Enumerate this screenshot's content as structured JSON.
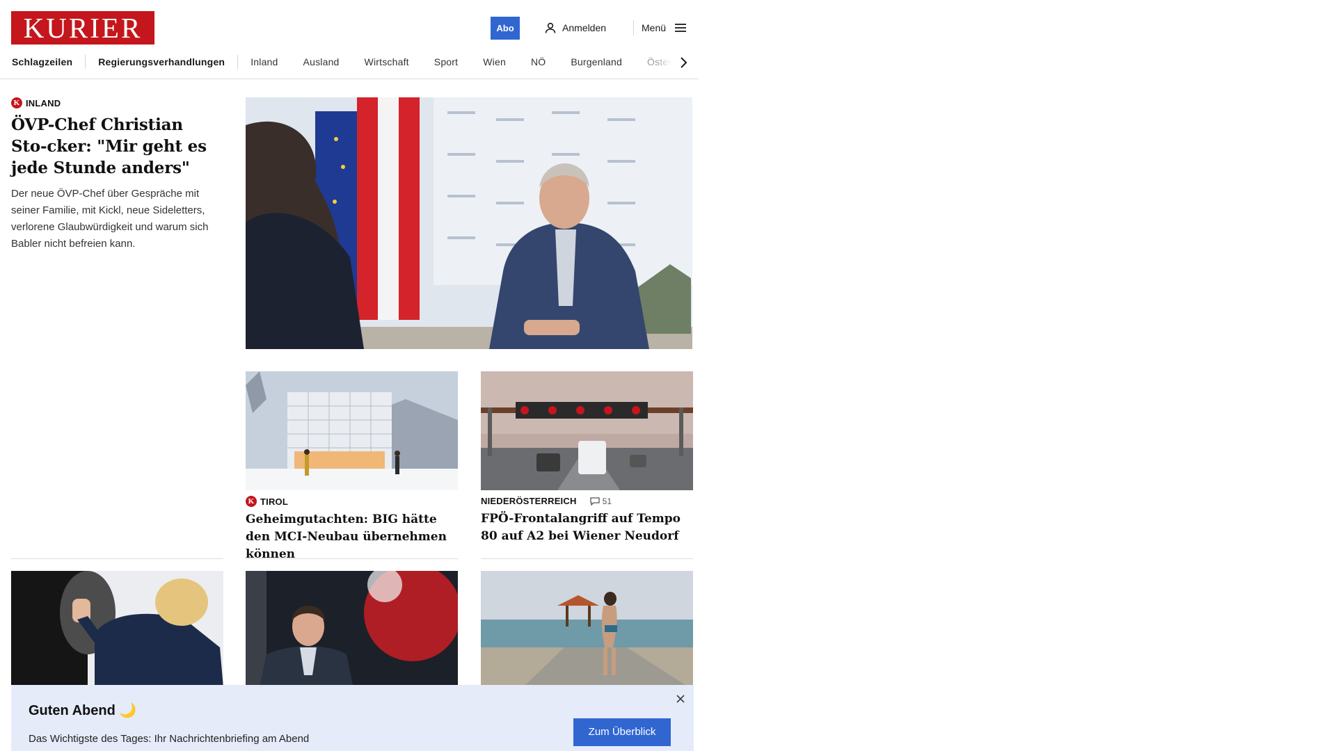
{
  "header": {
    "logo": "KURIER",
    "abo_label": "Abo",
    "login_label": "Anmelden",
    "menu_label": "Menü"
  },
  "nav": {
    "items": [
      "Schlagzeilen",
      "Regierungsverhandlungen",
      "Inland",
      "Ausland",
      "Wirtschaft",
      "Sport",
      "Wien",
      "NÖ",
      "Burgenland",
      "Öster"
    ]
  },
  "lead": {
    "section": "INLAND",
    "headline": "ÖVP-Chef Christian Sto-cker: \"Mir geht es jede Stunde anders\"",
    "teaser": "Der neue ÖVP-Chef über Gespräche mit seiner Familie, mit Kickl, neue Sideletters, verlorene Glaubwürdigkeit und warum sich Babler nicht befreien kann.",
    "image": "press-interview-photo"
  },
  "cards": [
    {
      "section": "TIROL",
      "headline": "Geheimgutachten: BIG hätte den MCI-Neubau übernehmen können",
      "image": "building-rendering-photo",
      "premium": true
    },
    {
      "section": "NIEDERÖSTERREICH",
      "comment_count": "51",
      "headline": "FPÖ-Frontalangriff auf Tempo 80 auf A2 bei Wiener Neudorf",
      "image": "highway-speed-sign-photo",
      "premium": false
    }
  ],
  "row3_images": [
    "trump-door-photo",
    "tv-politician-photo",
    "beach-photo"
  ],
  "banner": {
    "title": "Guten Abend 🌙",
    "text": "Das Wichtigste des Tages: Ihr Nachrichtenbriefing am Abend",
    "button": "Zum Überblick"
  },
  "colors": {
    "brand_red": "#c4161c",
    "accent_blue": "#3166d1",
    "banner_bg": "#e5ebf9"
  }
}
